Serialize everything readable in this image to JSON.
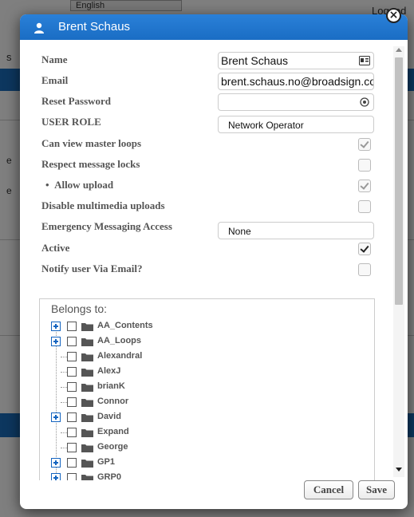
{
  "background": {
    "language_select": "English",
    "logged_text": "Logged",
    "left_s": "s",
    "left_e1": "e",
    "left_e2": "e"
  },
  "dialog": {
    "title": "Brent Schaus",
    "fields": {
      "name_label": "Name",
      "name_value": "Brent Schaus",
      "email_label": "Email",
      "email_value": "brent.schaus.no@broadsign.co",
      "reset_password_label": "Reset Password",
      "reset_password_value": "",
      "user_role_label": "USER ROLE",
      "user_role_value": "Network Operator",
      "can_view_master_loops_label": "Can view master loops",
      "can_view_master_loops_checked": true,
      "respect_message_locks_label": "Respect message locks",
      "respect_message_locks_checked": false,
      "allow_upload_label": "Allow upload",
      "allow_upload_bullet": "•",
      "allow_upload_checked": true,
      "disable_multimedia_uploads_label": "Disable multimedia uploads",
      "disable_multimedia_uploads_checked": false,
      "emergency_messaging_access_label": "Emergency Messaging Access",
      "emergency_messaging_access_value": "None",
      "active_label": "Active",
      "active_checked": true,
      "notify_user_label": "Notify user Via Email?",
      "notify_user_checked": false
    },
    "belongs_to": {
      "title": "Belongs to:",
      "items": [
        {
          "label": "AA_Contents",
          "expandable": true
        },
        {
          "label": "AA_Loops",
          "expandable": true
        },
        {
          "label": "Alexandral",
          "expandable": false
        },
        {
          "label": "AlexJ",
          "expandable": false
        },
        {
          "label": "brianK",
          "expandable": false
        },
        {
          "label": "Connor",
          "expandable": false
        },
        {
          "label": "David",
          "expandable": true
        },
        {
          "label": "Expand",
          "expandable": false
        },
        {
          "label": "George",
          "expandable": false
        },
        {
          "label": "GP1",
          "expandable": true
        },
        {
          "label": "GRP0",
          "expandable": true
        }
      ]
    },
    "buttons": {
      "cancel": "Cancel",
      "save": "Save"
    }
  },
  "colors": {
    "titlebar": "#1a6dc4",
    "accent": "#1565c0"
  }
}
